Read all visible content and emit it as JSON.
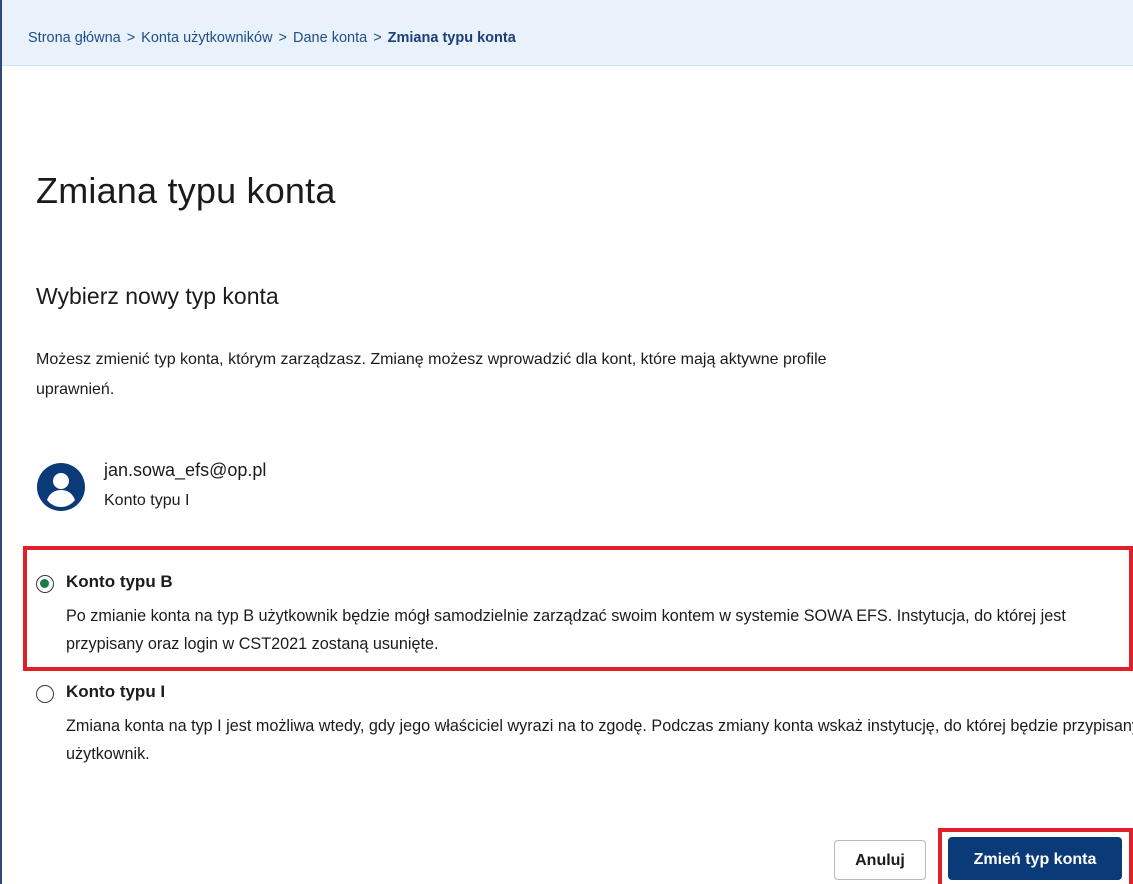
{
  "breadcrumb": {
    "items": [
      "Strona główna",
      "Konta użytkowników",
      "Dane konta"
    ],
    "separator": ">",
    "current": "Zmiana typu konta"
  },
  "page": {
    "title": "Zmiana typu konta",
    "section_title": "Wybierz nowy typ konta",
    "description": "Możesz zmienić typ konta, którym zarządzasz. Zmianę możesz wprowadzić dla kont, które mają aktywne profile uprawnień."
  },
  "user": {
    "email": "jan.sowa_efs@op.pl",
    "account_type": "Konto typu I",
    "avatar_icon": "user-circle-icon"
  },
  "options": [
    {
      "label": "Konto typu B",
      "selected": true,
      "description": "Po zmianie konta na typ B użytkownik będzie mógł samodzielnie zarządzać swoim kontem w systemie SOWA EFS. Instytucja, do której jest przypisany oraz login w CST2021 zostaną usunięte."
    },
    {
      "label": "Konto typu I",
      "selected": false,
      "description": "Zmiana konta na typ I jest możliwa wtedy, gdy jego właściciel wyrazi na to zgodę. Podczas zmiany konta wskaż instytucję, do której będzie przypisany użytkownik."
    }
  ],
  "actions": {
    "cancel_label": "Anuluj",
    "submit_label": "Zmień typ konta"
  },
  "colors": {
    "primary": "#0b3a78",
    "breadcrumb_bg": "#e9f2fb",
    "highlight": "#e02028",
    "radio_selected": "#1b7c4b"
  }
}
